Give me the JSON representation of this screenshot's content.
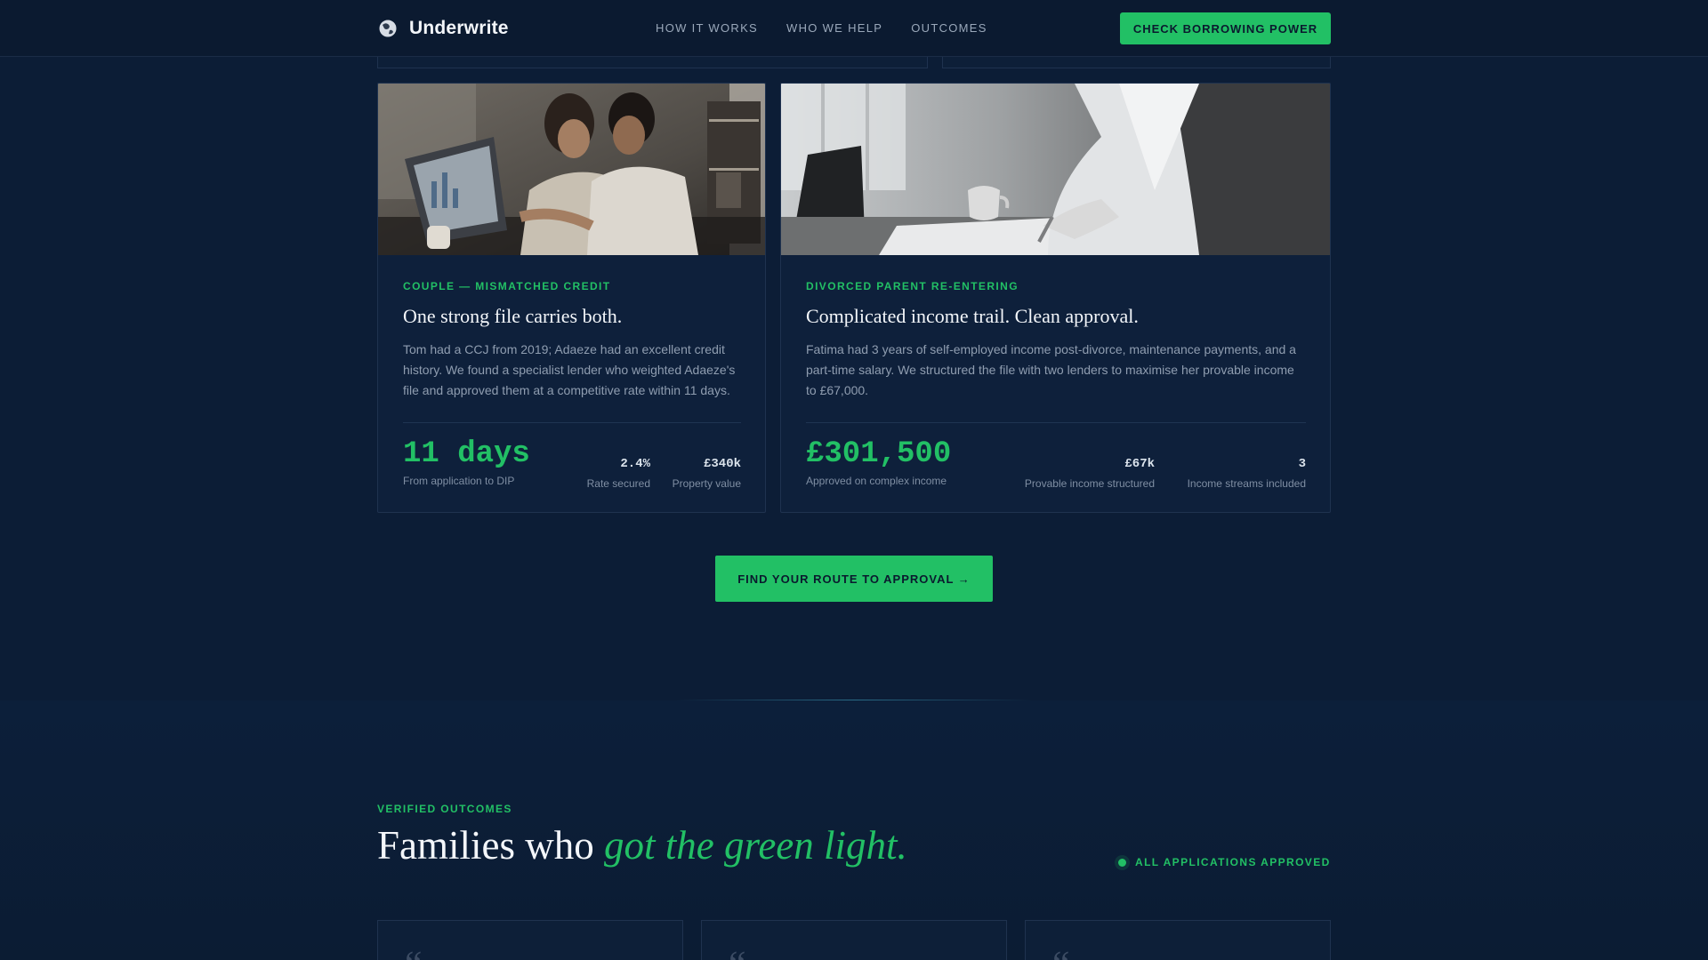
{
  "header": {
    "brand": "Underwrite",
    "nav": [
      "HOW IT WORKS",
      "WHO WE HELP",
      "OUTCOMES"
    ],
    "cta": "CHECK BORROWING POWER"
  },
  "cases": [
    {
      "tag": "COUPLE — MISMATCHED CREDIT",
      "title": "One strong file carries both.",
      "body": "Tom had a CCJ from 2019; Adaeze had an excellent credit history. We found a specialist lender who weighted Adaeze's file and approved them at a competitive rate within 11 days.",
      "big_value": "11 days",
      "big_caption": "From application to DIP",
      "stats": [
        {
          "value": "2.4%",
          "label": "Rate secured"
        },
        {
          "value": "£340k",
          "label": "Property value"
        }
      ]
    },
    {
      "tag": "DIVORCED PARENT RE-ENTERING",
      "title": "Complicated income trail. Clean approval.",
      "body": "Fatima had 3 years of self-employed income post-divorce, maintenance payments, and a part-time salary. We structured the file with two lenders to maximise her provable income to £67,000.",
      "big_value": "£301,500",
      "big_caption": "Approved on complex income",
      "stats": [
        {
          "value": "£67k",
          "label": "Provable income structured"
        },
        {
          "value": "3",
          "label": "Income streams included"
        }
      ]
    }
  ],
  "center_cta": "FIND YOUR ROUTE TO APPROVAL →",
  "outcomes": {
    "eyebrow": "VERIFIED OUTCOMES",
    "title_plain": "Families who ",
    "title_accent": "got the green light.",
    "badge": "ALL APPLICATIONS APPROVED",
    "quote_mark": "“"
  },
  "colors": {
    "accent": "#22c065",
    "background": "#0c1d36",
    "card": "#0e203b"
  }
}
